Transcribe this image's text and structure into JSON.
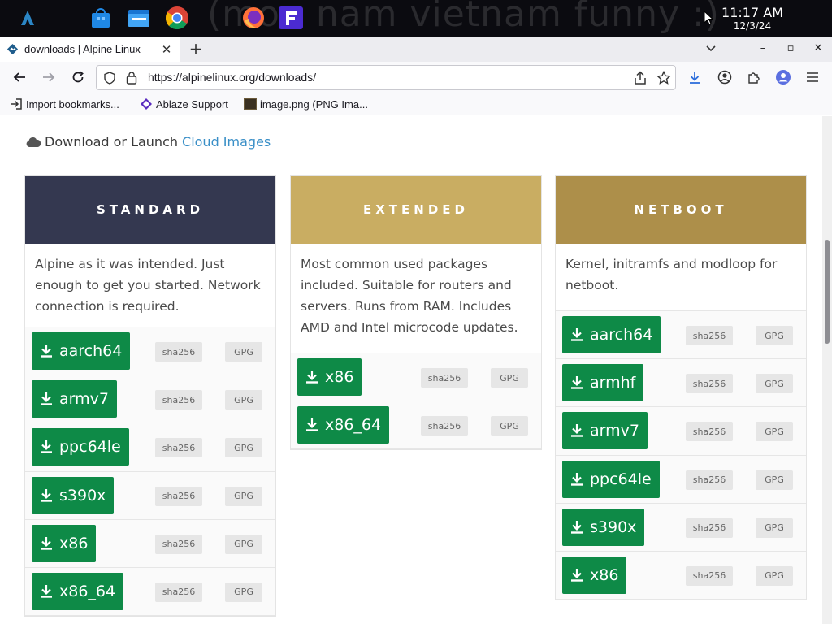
{
  "taskbar": {
    "wallpaper_text": "(mon nam vietnam funny :)",
    "clock_time": "11:17 AM",
    "clock_date": "12/3/24",
    "icons": [
      "alpine-logo-icon",
      "store-icon",
      "files-icon",
      "chrome-icon",
      "firefox-icon",
      "f-app-icon"
    ]
  },
  "browser": {
    "tab_title": "downloads | Alpine Linux",
    "tab_close": "✕",
    "new_tab": "+",
    "window_controls": {
      "minimize": "–",
      "maximize": "▫",
      "close": "✕"
    },
    "url": "https://alpinelinux.org/downloads/",
    "bookmarks": [
      {
        "label": "Import bookmarks...",
        "icon": "import-icon"
      },
      {
        "label": "Ablaze Support",
        "icon": "ablaze-icon"
      },
      {
        "label": "image.png (PNG Ima...",
        "icon": "image-thumb-icon"
      }
    ]
  },
  "page": {
    "cloud_prefix": "Download or Launch",
    "cloud_link": "Cloud Images",
    "columns": [
      {
        "title": "STANDARD",
        "header_color": "#343850",
        "title_color": "#ffffff",
        "description": "Alpine as it was intended. Just enough to get you started. Network connection is required.",
        "downloads": [
          "aarch64",
          "armv7",
          "ppc64le",
          "s390x",
          "x86",
          "x86_64"
        ]
      },
      {
        "title": "EXTENDED",
        "header_color": "#c9ad62",
        "title_color": "#ffffff",
        "description": "Most common used packages included. Suitable for routers and servers. Runs from RAM. Includes AMD and Intel microcode updates.",
        "downloads": [
          "x86",
          "x86_64"
        ]
      },
      {
        "title": "NETBOOT",
        "header_color": "#ad8f4a",
        "title_color": "#ffffff",
        "description": "Kernel, initramfs and modloop for netboot.",
        "downloads": [
          "aarch64",
          "armhf",
          "armv7",
          "ppc64le",
          "s390x",
          "x86"
        ]
      }
    ],
    "sha_label": "sha256",
    "gpg_label": "GPG",
    "accent_green": "#0e8a47"
  }
}
